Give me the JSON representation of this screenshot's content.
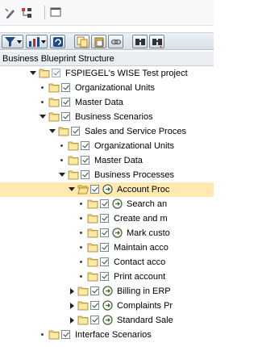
{
  "toolbar1": {
    "buttons": [
      {
        "name": "edit-pencil-icon"
      },
      {
        "name": "structure-icon"
      },
      {
        "name": "window-icon"
      }
    ]
  },
  "toolbar2": {
    "buttons": [
      {
        "name": "filter-icon",
        "has_dropdown": true
      },
      {
        "name": "chart-icon",
        "has_dropdown": true
      },
      {
        "name": "refresh-icon"
      },
      {
        "name": "copy-icon"
      },
      {
        "name": "paste-icon"
      },
      {
        "name": "link-icon"
      },
      {
        "name": "find-icon"
      },
      {
        "name": "find-next-icon"
      }
    ]
  },
  "tree_header": "Business Blueprint Structure",
  "tree": [
    {
      "level": 0,
      "expander": "down",
      "folder": true,
      "checked": true,
      "grey": true,
      "process": false,
      "label": "FSPIEGEL's WISE Test project"
    },
    {
      "level": 1,
      "expander": "dot",
      "folder": true,
      "checked": true,
      "grey": false,
      "process": false,
      "label": "Organizational Units"
    },
    {
      "level": 1,
      "expander": "dot",
      "folder": true,
      "checked": true,
      "grey": false,
      "process": false,
      "label": "Master Data"
    },
    {
      "level": 1,
      "expander": "down",
      "folder": true,
      "checked": true,
      "grey": false,
      "process": false,
      "label": "Business Scenarios"
    },
    {
      "level": 2,
      "expander": "down",
      "folder": true,
      "checked": true,
      "grey": false,
      "process": false,
      "label": "Sales and Service Proces"
    },
    {
      "level": 3,
      "expander": "dot",
      "folder": true,
      "checked": true,
      "grey": false,
      "process": false,
      "label": "Organizational Units"
    },
    {
      "level": 3,
      "expander": "dot",
      "folder": true,
      "checked": true,
      "grey": false,
      "process": false,
      "label": "Master Data"
    },
    {
      "level": 3,
      "expander": "down",
      "folder": true,
      "checked": true,
      "grey": false,
      "process": false,
      "label": "Business Processes"
    },
    {
      "level": 4,
      "expander": "down",
      "folder": "open",
      "checked": true,
      "grey": false,
      "process": true,
      "label": "Account Proc",
      "selected": true
    },
    {
      "level": 5,
      "expander": "dot",
      "folder": true,
      "checked": true,
      "grey": false,
      "process": true,
      "label": "Search an"
    },
    {
      "level": 5,
      "expander": "dot",
      "folder": true,
      "checked": true,
      "grey": false,
      "process": false,
      "label": "Create and m"
    },
    {
      "level": 5,
      "expander": "dot",
      "folder": true,
      "checked": true,
      "grey": false,
      "process": true,
      "label": "Mark custo"
    },
    {
      "level": 5,
      "expander": "dot",
      "folder": true,
      "checked": true,
      "grey": false,
      "process": false,
      "label": "Maintain acco"
    },
    {
      "level": 5,
      "expander": "dot",
      "folder": true,
      "checked": true,
      "grey": false,
      "process": false,
      "label": "Contact acco"
    },
    {
      "level": 5,
      "expander": "dot",
      "folder": true,
      "checked": true,
      "grey": false,
      "process": false,
      "label": "Print account"
    },
    {
      "level": 4,
      "expander": "right",
      "folder": true,
      "checked": true,
      "grey": false,
      "process": true,
      "label": "Billing in ERP"
    },
    {
      "level": 4,
      "expander": "right",
      "folder": true,
      "checked": true,
      "grey": false,
      "process": true,
      "label": "Complaints Pr"
    },
    {
      "level": 4,
      "expander": "right",
      "folder": true,
      "checked": true,
      "grey": false,
      "process": true,
      "label": "Standard Sale"
    },
    {
      "level": 1,
      "expander": "dot",
      "folder": true,
      "checked": true,
      "grey": false,
      "process": false,
      "label": "Interface Scenarios"
    }
  ],
  "colors": {
    "folder_fill": "#f4d772",
    "folder_stroke": "#9c7a1d",
    "selection": "#ffe9b0",
    "process_icon": "#4a6b3a"
  }
}
